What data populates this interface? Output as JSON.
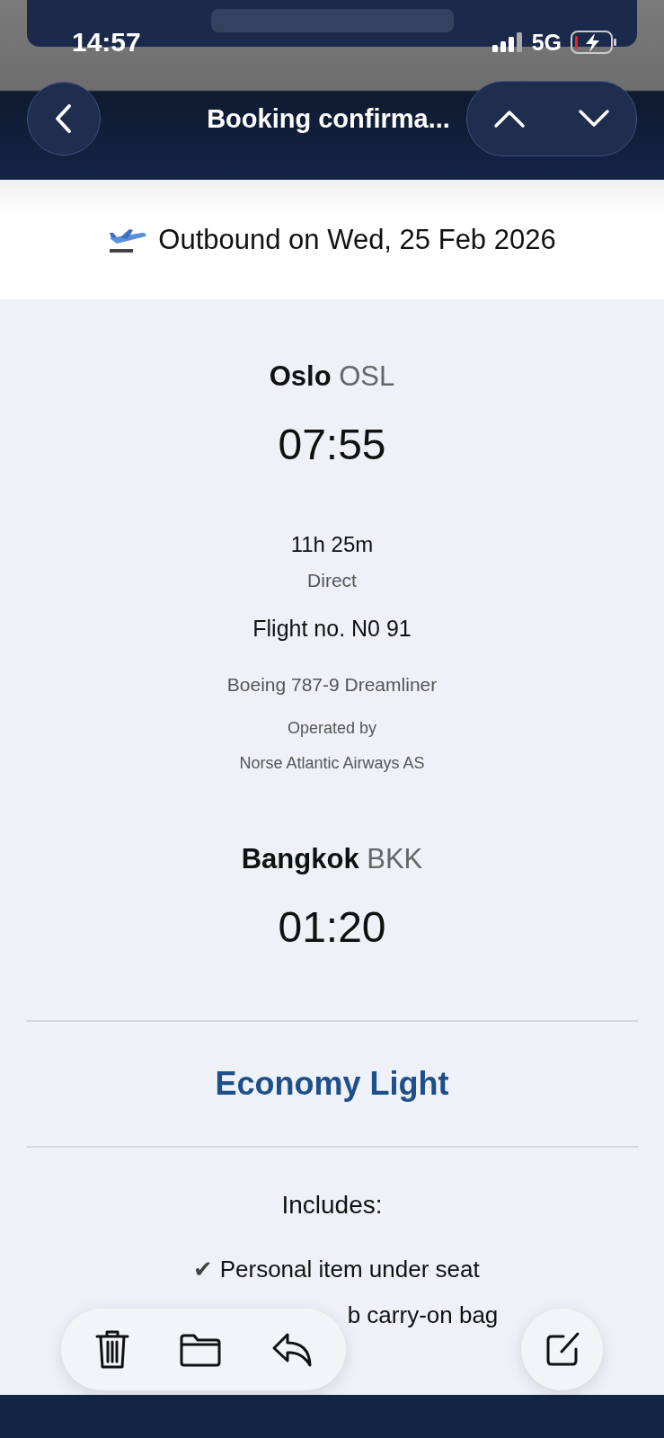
{
  "status_bar": {
    "time": "14:57",
    "network": "5G"
  },
  "nav": {
    "title": "Booking confirma..."
  },
  "header": {
    "text": "Outbound on Wed, 25 Feb 2026"
  },
  "departure": {
    "city": "Oslo",
    "code": "OSL",
    "time": "07:55"
  },
  "flight": {
    "duration": "11h 25m",
    "stops": "Direct",
    "number": "Flight no. N0 91",
    "aircraft": "Boeing 787-9 Dreamliner",
    "operated_label": "Operated by",
    "operator": "Norse Atlantic Airways AS"
  },
  "arrival": {
    "city": "Bangkok",
    "code": "BKK",
    "time": "01:20"
  },
  "fare": {
    "name": "Economy Light",
    "includes_label": "Includes:",
    "items": [
      {
        "mark": "✔",
        "text": "Personal item under seat"
      },
      {
        "text": "b carry-on bag"
      }
    ]
  }
}
